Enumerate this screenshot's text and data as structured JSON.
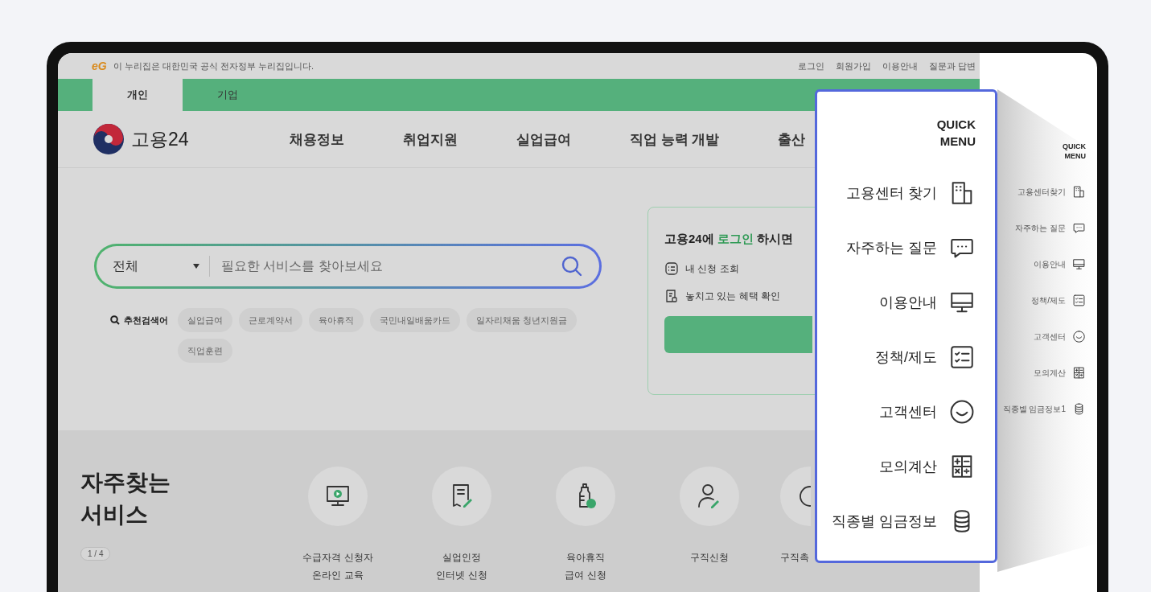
{
  "top_bar": {
    "logo": "eG",
    "notice": "이 누리집은 대한민국 공식 전자정부 누리집입니다.",
    "links": [
      "로그인",
      "회원가입",
      "이용안내",
      "질문과 답변"
    ]
  },
  "tabs": [
    {
      "label": "개인",
      "selected": true
    },
    {
      "label": "기업",
      "selected": false
    }
  ],
  "header": {
    "logo": "고용24",
    "nav": [
      "채용정보",
      "취업지원",
      "실업급여",
      "직업 능력 개발",
      "출산"
    ]
  },
  "search": {
    "scope": "전체",
    "placeholder": "필요한 서비스를 찾아보세요",
    "recommend_label": "추천검색어",
    "keywords": [
      "실업급여",
      "근로계약서",
      "육아휴직",
      "국민내일배움카드",
      "일자리채움 청년지원금",
      "직업훈련"
    ]
  },
  "login_card": {
    "title_before": "고용24에",
    "title_link": "로그인",
    "title_after": "하시면",
    "links": [
      {
        "kind": "list",
        "label": "내 신청 조회"
      },
      {
        "kind": "doc",
        "label": "놓치고 있는 혜택 확인"
      }
    ]
  },
  "services": {
    "title": "자주찾는 서비스",
    "page": "1 / 4",
    "items": [
      {
        "kind": "monitor",
        "lines": [
          "수급자격 신청자",
          "온라인 교육"
        ]
      },
      {
        "kind": "doc",
        "lines": [
          "실업인정",
          "인터넷 신청"
        ]
      },
      {
        "kind": "bottle",
        "lines": [
          "육아휴직",
          "급여 신청"
        ]
      },
      {
        "kind": "person",
        "lines": [
          "구직신청"
        ]
      },
      {
        "kind": "circle",
        "lines": [
          "구직촉"
        ]
      }
    ]
  },
  "quick_menu": {
    "title": "QUICK MENU",
    "items": [
      {
        "kind": "building",
        "label": "고용센터찾기"
      },
      {
        "kind": "chat",
        "label": "자주하는 질문"
      },
      {
        "kind": "monitor",
        "label": "이용안내"
      },
      {
        "kind": "checklist",
        "label": "정책/제도"
      },
      {
        "kind": "smile",
        "label": "고객센터"
      },
      {
        "kind": "calculator",
        "label": "모의계산"
      },
      {
        "kind": "coins",
        "label": "직종별 임금정보1"
      }
    ]
  },
  "quick_menu_zoom": {
    "title": "QUICK MENU",
    "items": [
      {
        "kind": "building",
        "label": "고용센터 찾기"
      },
      {
        "kind": "chat",
        "label": "자주하는 질문"
      },
      {
        "kind": "monitor",
        "label": "이용안내"
      },
      {
        "kind": "checklist",
        "label": "정책/제도"
      },
      {
        "kind": "smile",
        "label": "고객센터"
      },
      {
        "kind": "calculator",
        "label": "모의계산"
      },
      {
        "kind": "coins",
        "label": "직종별 임금정보"
      }
    ]
  }
}
